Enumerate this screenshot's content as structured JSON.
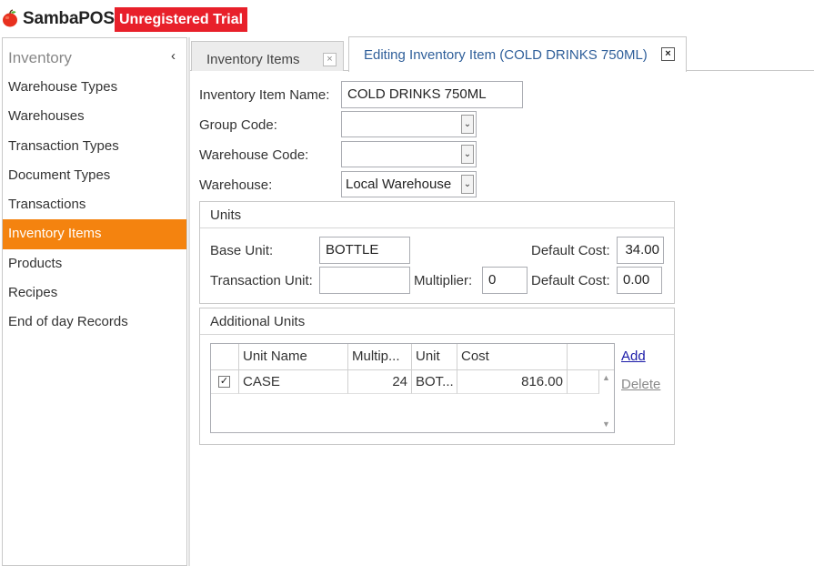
{
  "app": {
    "name": "SambaPOS",
    "trial_badge": "Unregistered Trial",
    "logo_icon": "red-apple-icon",
    "colors": {
      "badge": "#e8202a",
      "accent": "#f4830f",
      "tab_active_text": "#2f5f9a"
    }
  },
  "sidebar": {
    "title": "Inventory",
    "collapse_glyph": "‹",
    "items": [
      {
        "label": "Warehouse Types"
      },
      {
        "label": "Warehouses"
      },
      {
        "label": "Transaction Types"
      },
      {
        "label": "Document Types"
      },
      {
        "label": "Transactions"
      },
      {
        "label": "Inventory Items",
        "active": true
      },
      {
        "label": "Products"
      },
      {
        "label": "Recipes"
      },
      {
        "label": "End of day Records"
      }
    ]
  },
  "tabs": [
    {
      "label": "Inventory Items",
      "close": "×",
      "active": false
    },
    {
      "label": "Editing Inventory Item (COLD DRINKS 750ML)",
      "close": "×",
      "active": true
    }
  ],
  "form": {
    "name_label": "Inventory Item Name:",
    "name_value": "COLD DRINKS 750ML",
    "group_code_label": "Group Code:",
    "group_code_value": "",
    "warehouse_code_label": "Warehouse Code:",
    "warehouse_code_value": "",
    "warehouse_label": "Warehouse:",
    "warehouse_value": "Local Warehouse",
    "dropdown_glyph": "⌄"
  },
  "units": {
    "title": "Units",
    "base_unit_label": "Base Unit:",
    "base_unit_value": "BOTTLE",
    "default_cost_label_1": "Default Cost:",
    "default_cost_value_1": "34.00",
    "transaction_unit_label": "Transaction Unit:",
    "transaction_unit_value": "",
    "multiplier_label": "Multiplier:",
    "multiplier_value": "0",
    "default_cost_label_2": "Default Cost:",
    "default_cost_value_2": "0.00"
  },
  "additional_units": {
    "title": "Additional Units",
    "columns": [
      "",
      "Unit Name",
      "Multip...",
      "Unit",
      "Cost",
      ""
    ],
    "rows": [
      {
        "checked": "✓",
        "unit_name": "CASE",
        "multiplier": "24",
        "unit": "BOT...",
        "cost": "816.00"
      }
    ],
    "add_label": "Add",
    "delete_label": "Delete",
    "scroll_up": "▲",
    "scroll_down": "▼"
  }
}
